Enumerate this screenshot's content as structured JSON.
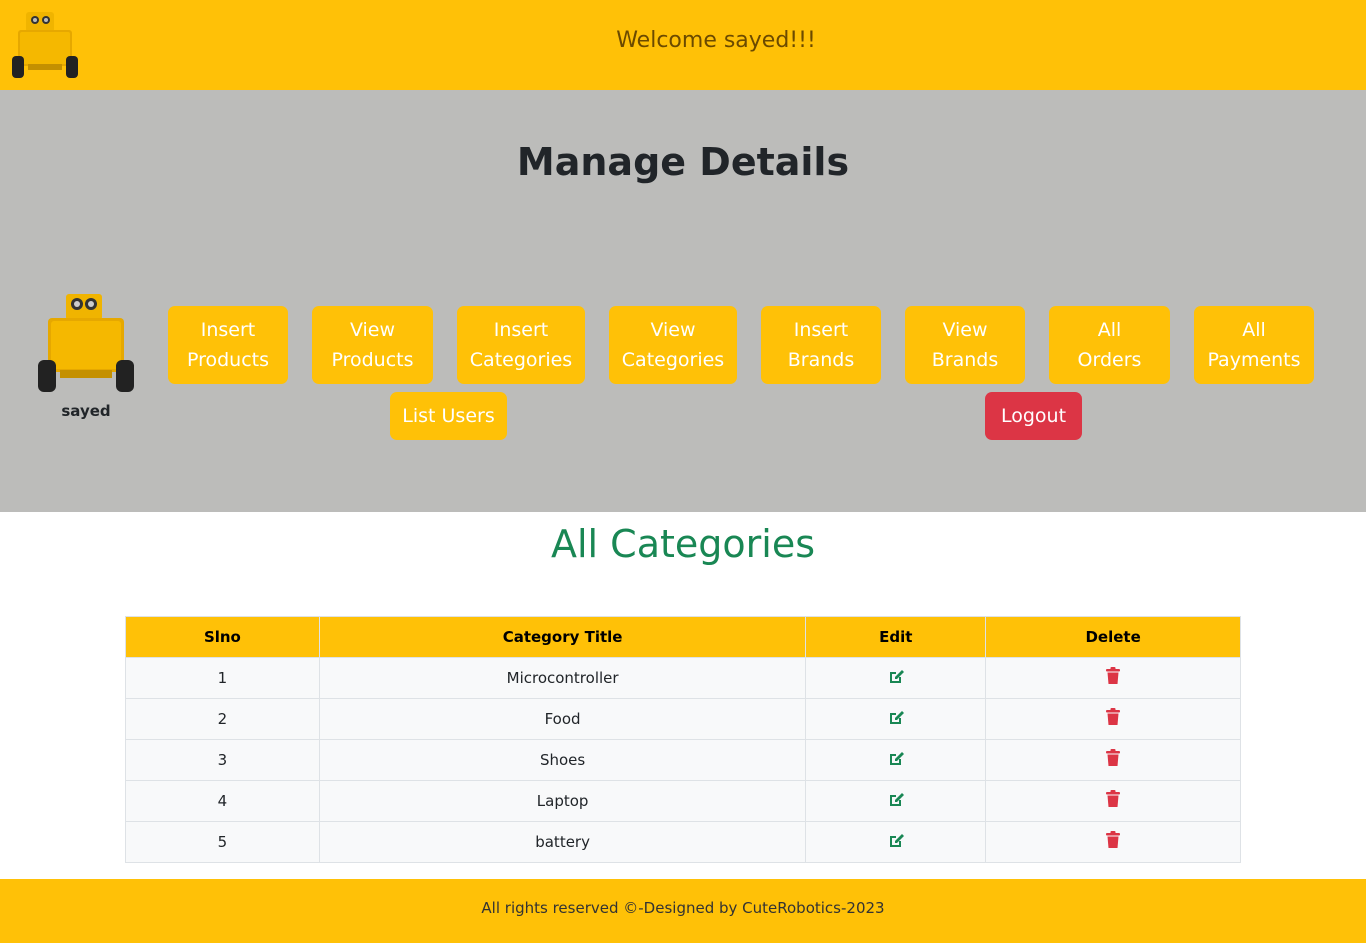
{
  "header": {
    "welcome": "Welcome sayed!!!",
    "logo_icon": "robot-icon"
  },
  "manage": {
    "title": "Manage Details",
    "user_name": "sayed",
    "buttons": [
      {
        "line1": "Insert",
        "line2": "Products"
      },
      {
        "line1": "View",
        "line2": "Products"
      },
      {
        "line1": "Insert",
        "line2": "Categories"
      },
      {
        "line1": "View",
        "line2": "Categories"
      },
      {
        "line1": "Insert",
        "line2": "Brands"
      },
      {
        "line1": "View",
        "line2": "Brands"
      },
      {
        "line1": "All",
        "line2": "Orders"
      },
      {
        "line1": "All",
        "line2": "Payments"
      }
    ],
    "list_users": "List Users",
    "logout": "Logout"
  },
  "categories": {
    "title": "All Categories",
    "columns": [
      "Slno",
      "Category Title",
      "Edit",
      "Delete"
    ],
    "rows": [
      {
        "slno": "1",
        "title": "Microcontroller"
      },
      {
        "slno": "2",
        "title": "Food"
      },
      {
        "slno": "3",
        "title": "Shoes"
      },
      {
        "slno": "4",
        "title": "Laptop"
      },
      {
        "slno": "5",
        "title": "battery"
      }
    ]
  },
  "colors": {
    "accent": "#ffc107",
    "panel": "#bcbcba",
    "success": "#198754",
    "danger": "#dc3545"
  },
  "footer": {
    "text": "All rights reserved ©-Designed by CuteRobotics-2023"
  }
}
